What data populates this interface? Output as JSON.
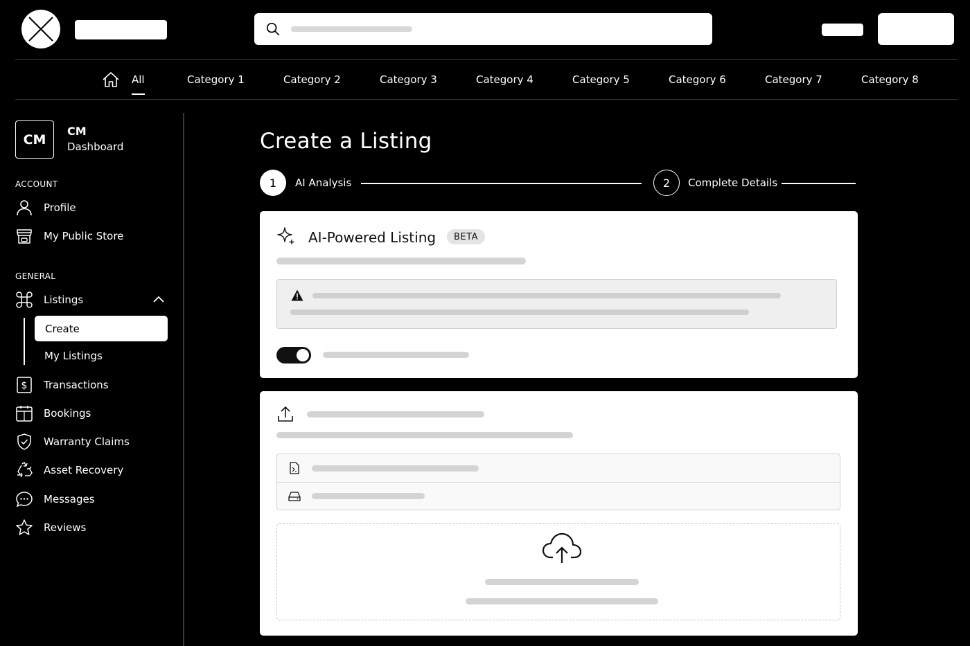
{
  "nav": {
    "categories": [
      "All",
      "Category 1",
      "Category 2",
      "Category 3",
      "Category 4",
      "Category 5",
      "Category 6",
      "Category 7",
      "Category 8"
    ],
    "active_category": "All"
  },
  "sidebar": {
    "avatar_initials": "CM",
    "user_name": "CM",
    "user_subtitle": "Dashboard",
    "account_label": "ACCOUNT",
    "general_label": "GENERAL",
    "items": {
      "profile": "Profile",
      "store": "My Public Store",
      "listings": "Listings",
      "create": "Create",
      "my_listings": "My Listings",
      "transactions": "Transactions",
      "bookings": "Bookings",
      "warranty": "Warranty Claims",
      "asset_recovery": "Asset Recovery",
      "messages": "Messages",
      "reviews": "Reviews"
    }
  },
  "main": {
    "title": "Create a Listing",
    "steps": [
      {
        "number": "1",
        "label": "AI Analysis"
      },
      {
        "number": "2",
        "label": "Complete Details"
      }
    ],
    "ai_card": {
      "title": "AI-Powered Listing",
      "badge": "BETA",
      "toggle_on": true
    }
  },
  "icons": [
    "logo-icon",
    "search-icon",
    "home-icon",
    "profile-icon",
    "store-icon",
    "command-icon",
    "chevron-up-icon",
    "dollar-icon",
    "calendar-icon",
    "shield-icon",
    "recycle-icon",
    "chat-icon",
    "star-icon",
    "sparkle-icon",
    "warning-icon",
    "upload-icon",
    "file-icon",
    "drive-icon",
    "cloud-upload-icon"
  ]
}
